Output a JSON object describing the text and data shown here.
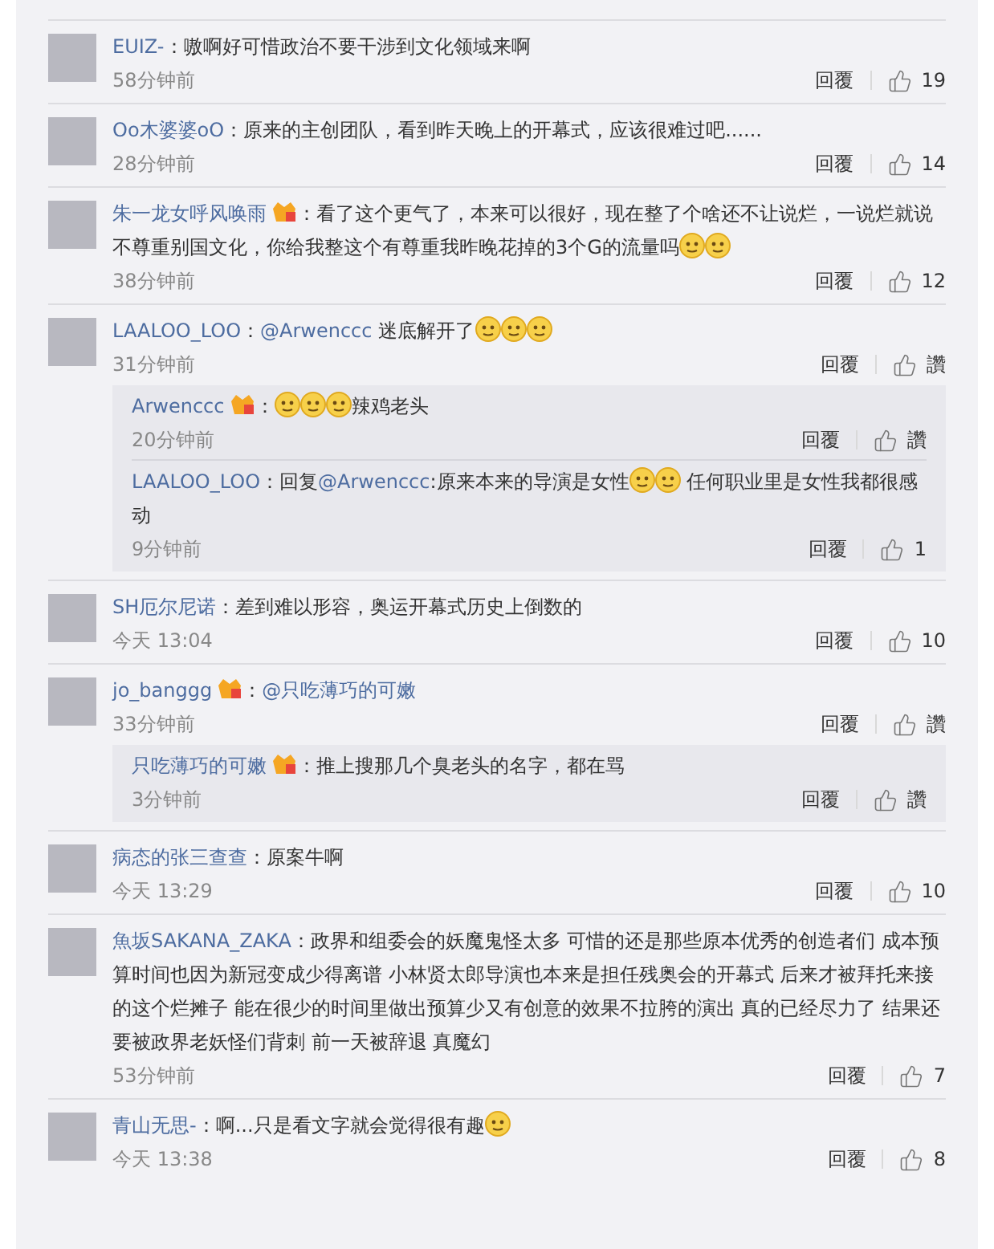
{
  "comments": [
    {
      "user": "EUIZ-",
      "badge": false,
      "parts": [
        {
          "kind": "text",
          "text": "：嗷啊好可惜政治不要干涉到文化领域来啊"
        }
      ],
      "time": "58分钟前",
      "reply": "回覆",
      "likes": "19"
    },
    {
      "user": "Oo木婆婆oO",
      "badge": false,
      "parts": [
        {
          "kind": "text",
          "text": "：原来的主创团队，看到昨天晚上的开幕式，应该很难过吧......"
        }
      ],
      "time": "28分钟前",
      "reply": "回覆",
      "likes": "14"
    },
    {
      "user": "朱一龙女呼风唤雨",
      "badge": true,
      "parts": [
        {
          "kind": "text",
          "text": "：看了这个更气了，本来可以很好，现在整了个啥还不让说烂，一说烂就说不尊重别国文化，你给我整这个有尊重我昨晚花掉的3个G的流量吗"
        },
        {
          "kind": "emoji"
        },
        {
          "kind": "emoji"
        }
      ],
      "time": "38分钟前",
      "reply": "回覆",
      "likes": "12"
    },
    {
      "user": "LAALOO_LOO",
      "badge": false,
      "parts": [
        {
          "kind": "text",
          "text": "："
        },
        {
          "kind": "mention",
          "text": "@Arwenccc"
        },
        {
          "kind": "text",
          "text": " 迷底解开了"
        },
        {
          "kind": "emoji"
        },
        {
          "kind": "emoji"
        },
        {
          "kind": "emoji"
        }
      ],
      "time": "31分钟前",
      "reply": "回覆",
      "likes": "讚",
      "replies": [
        {
          "user": "Arwenccc",
          "badge": true,
          "parts": [
            {
              "kind": "text",
              "text": "："
            },
            {
              "kind": "emoji"
            },
            {
              "kind": "emoji"
            },
            {
              "kind": "emoji"
            },
            {
              "kind": "text",
              "text": "辣鸡老头"
            }
          ],
          "time": "20分钟前",
          "reply": "回覆",
          "likes": "讚"
        },
        {
          "user": "LAALOO_LOO",
          "badge": false,
          "parts": [
            {
              "kind": "text",
              "text": "：回复"
            },
            {
              "kind": "mention",
              "text": "@Arwenccc"
            },
            {
              "kind": "text",
              "text": ":原来本来的导演是女性"
            },
            {
              "kind": "emoji"
            },
            {
              "kind": "emoji"
            },
            {
              "kind": "text",
              "text": " 任何职业里是女性我都很感动"
            }
          ],
          "time": "9分钟前",
          "reply": "回覆",
          "likes": "1"
        }
      ]
    },
    {
      "user": "SH厄尔尼诺",
      "badge": false,
      "parts": [
        {
          "kind": "text",
          "text": "：差到难以形容，奥运开幕式历史上倒数的"
        }
      ],
      "time": "今天 13:04",
      "reply": "回覆",
      "likes": "10"
    },
    {
      "user": "jo_banggg",
      "badge": true,
      "parts": [
        {
          "kind": "text",
          "text": "："
        },
        {
          "kind": "mention",
          "text": "@只吃薄巧的可嫩"
        }
      ],
      "time": "33分钟前",
      "reply": "回覆",
      "likes": "讚",
      "replies": [
        {
          "user": "只吃薄巧的可嫩",
          "badge": true,
          "parts": [
            {
              "kind": "text",
              "text": "：推上搜那几个臭老头的名字，都在骂"
            }
          ],
          "time": "3分钟前",
          "reply": "回覆",
          "likes": "讚"
        }
      ]
    },
    {
      "user": "病态的张三查查",
      "badge": false,
      "parts": [
        {
          "kind": "text",
          "text": "：原案牛啊"
        }
      ],
      "time": "今天 13:29",
      "reply": "回覆",
      "likes": "10"
    },
    {
      "user": "魚坂SAKANA_ZAKA",
      "badge": false,
      "parts": [
        {
          "kind": "text",
          "text": "：政界和组委会的妖魔鬼怪太多 可惜的还是那些原本优秀的创造者们 成本预算时间也因为新冠变成少得离谱 小林贤太郎导演也本来是担任残奥会的开幕式 后来才被拜托来接的这个烂摊子 能在很少的时间里做出预算少又有创意的效果不拉胯的演出 真的已经尽力了 结果还要被政界老妖怪们背刺 前一天被辞退 真魔幻"
        }
      ],
      "time": "53分钟前",
      "reply": "回覆",
      "likes": "7"
    },
    {
      "user": "青山无思-",
      "badge": false,
      "parts": [
        {
          "kind": "text",
          "text": "：啊...只是看文字就会觉得很有趣"
        },
        {
          "kind": "emoji"
        }
      ],
      "time": "今天 13:38",
      "reply": "回覆",
      "likes": "8"
    }
  ]
}
